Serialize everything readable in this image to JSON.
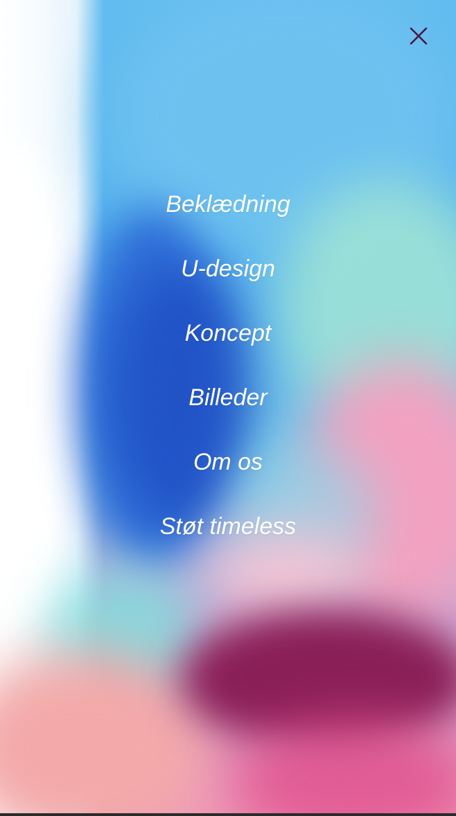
{
  "header": {
    "close_icon": "close-icon",
    "close_color": "#4a1640"
  },
  "menu": {
    "items": [
      {
        "label": "Beklædning"
      },
      {
        "label": "U-design"
      },
      {
        "label": "Koncept"
      },
      {
        "label": "Billeder"
      },
      {
        "label": "Om os"
      },
      {
        "label": "Støt timeless"
      }
    ],
    "text_color": "#ffffff"
  },
  "background": {
    "style": "abstract painted canvas",
    "colors": [
      "#62bdf0",
      "#2f6fd8",
      "#9fe3d6",
      "#f2a2c0",
      "#8a1f57",
      "#ffffff"
    ]
  }
}
